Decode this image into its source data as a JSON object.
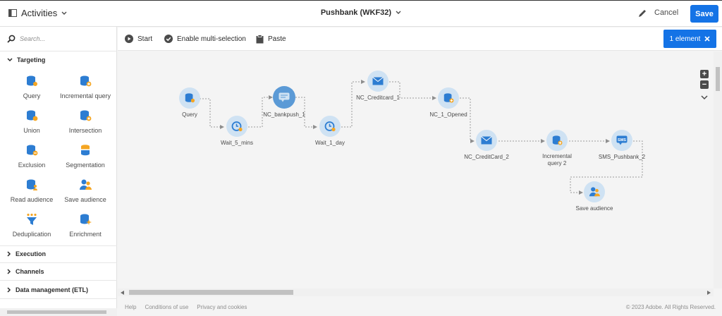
{
  "header": {
    "activities_label": "Activities",
    "workflow_title": "Pushbank (WKF32)",
    "cancel_label": "Cancel",
    "save_label": "Save"
  },
  "sidebar": {
    "search_placeholder": "Search...",
    "targeting_label": "Targeting",
    "activities": [
      {
        "label": "Query",
        "icon": "database-icon"
      },
      {
        "label": "Incremental query",
        "icon": "database-plus-icon"
      },
      {
        "label": "Union",
        "icon": "database-union-icon"
      },
      {
        "label": "Intersection",
        "icon": "database-intersection-icon"
      },
      {
        "label": "Exclusion",
        "icon": "database-exclusion-icon"
      },
      {
        "label": "Segmentation",
        "icon": "segmentation-icon"
      },
      {
        "label": "Read audience",
        "icon": "read-audience-icon"
      },
      {
        "label": "Save audience",
        "icon": "save-audience-icon"
      },
      {
        "label": "Deduplication",
        "icon": "funnel-icon"
      },
      {
        "label": "Enrichment",
        "icon": "enrichment-icon"
      }
    ],
    "sections": [
      {
        "label": "Execution"
      },
      {
        "label": "Channels"
      },
      {
        "label": "Data management (ETL)"
      }
    ]
  },
  "toolbar": {
    "start_label": "Start",
    "multi_select_label": "Enable multi-selection",
    "paste_label": "Paste",
    "selection_label": "1 element"
  },
  "workflow": {
    "nodes": [
      {
        "id": "query",
        "label": "Query",
        "icon": "database-icon"
      },
      {
        "id": "wait5",
        "label": "Wait_5_mins",
        "icon": "clock-icon"
      },
      {
        "id": "bankpush",
        "label": "NC_bankpush_1",
        "icon": "push-icon",
        "selected": true
      },
      {
        "id": "wait1d",
        "label": "Wait_1_day",
        "icon": "clock-icon"
      },
      {
        "id": "cc1",
        "label": "NC_Creditcard_1",
        "icon": "email-icon"
      },
      {
        "id": "opened",
        "label": "NC_1_Opened",
        "icon": "database-plus-icon"
      },
      {
        "id": "cc2",
        "label": "NC_CreditCard_2",
        "icon": "email-icon"
      },
      {
        "id": "incq2",
        "label": "Incremental query 2",
        "icon": "database-plus-icon"
      },
      {
        "id": "sms",
        "label": "SMS_Pushbank_2",
        "icon": "sms-icon"
      },
      {
        "id": "saveaud",
        "label": "Save audience",
        "icon": "save-audience-icon"
      }
    ]
  },
  "footer": {
    "help_label": "Help",
    "conditions_label": "Conditions of use",
    "privacy_label": "Privacy and cookies",
    "copyright": "© 2023 Adobe. All Rights Reserved."
  },
  "colors": {
    "accent": "#1473e6",
    "node_bg": "#cfe2f3",
    "node_selected": "#5b9ad6",
    "icon_blue": "#2d7dd2",
    "icon_orange": "#f5a623"
  }
}
